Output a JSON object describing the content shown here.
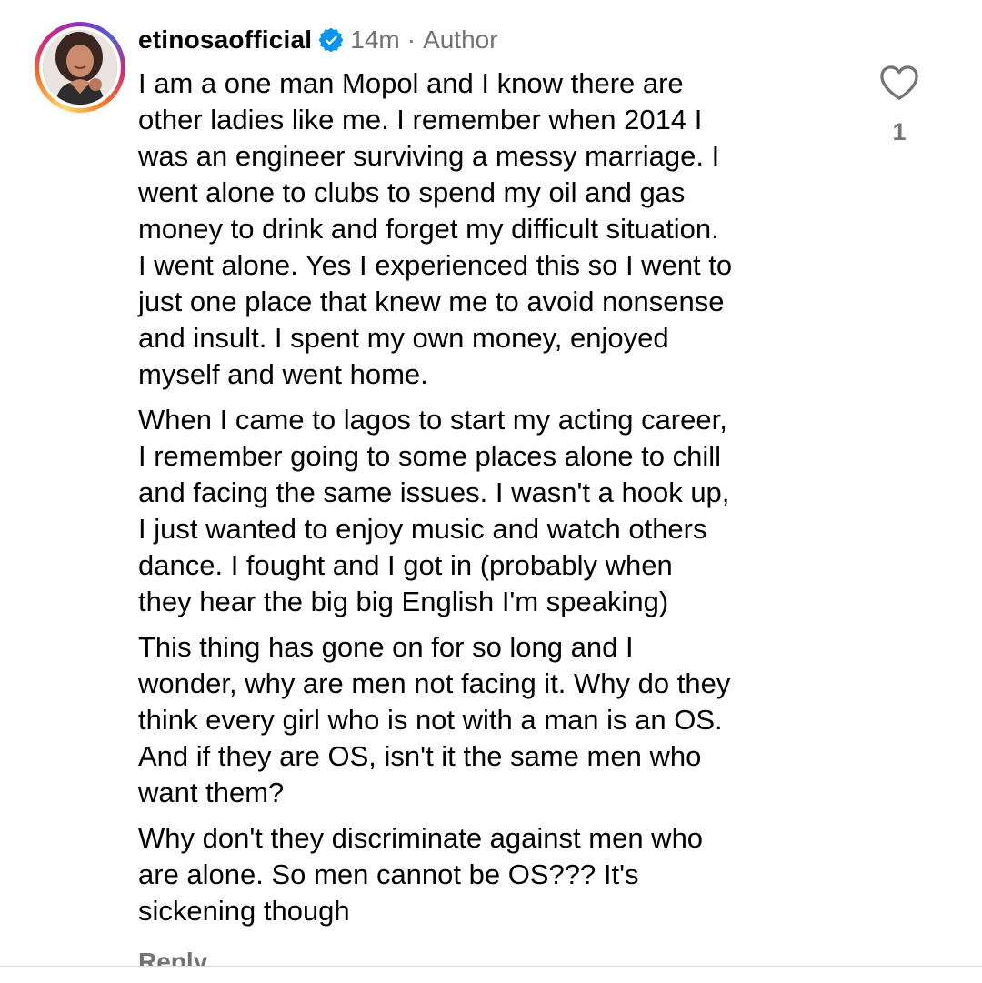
{
  "comment": {
    "username": "etinosaofficial",
    "time": "14m",
    "separator": "·",
    "role": "Author",
    "paragraphs": [
      "I am a one man Mopol and I know there are\nother ladies like me. I remember when 2014 I\nwas an engineer surviving a messy marriage. I\nwent alone to clubs to spend my oil and gas\nmoney to drink and forget my difficult situation.\nI went alone. Yes I experienced this so I went to\njust one place that knew me to avoid nonsense\nand insult. I spent my own money, enjoyed\nmyself and went home.",
      "When I came to lagos to start my acting career,\nI remember going to some places alone to chill\nand facing the same issues. I wasn't a hook up,\nI just wanted to enjoy music and watch others\ndance. I fought and I got in (probably when\nthey hear the big big English I'm speaking)",
      "This thing has gone on for so long and I\nwonder, why are men not facing it. Why do they\nthink every girl who is not with a man is an OS.\nAnd if they are OS, isn't it the same men who\nwant them?",
      "Why don't they discriminate against men who\nare alone. So men cannot be OS??? It's\nsickening though"
    ],
    "like_count": "1",
    "reply_label": "Reply"
  },
  "icons": {
    "verified": "verified-badge-icon",
    "like": "heart-outline-icon"
  },
  "colors": {
    "verified_blue": "#0095f6",
    "secondary_text": "#737373"
  }
}
